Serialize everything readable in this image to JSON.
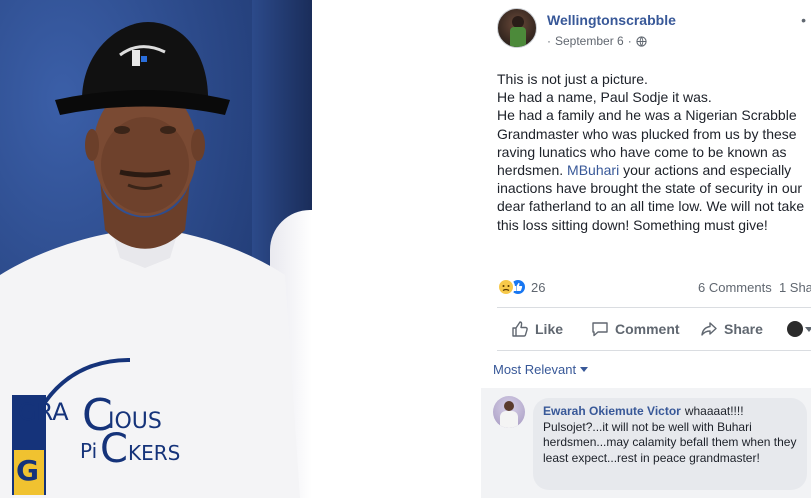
{
  "post": {
    "page_name": "Wellingtonscrabble",
    "date": "September 6",
    "separator": "·",
    "more": "•",
    "text_lines": [
      "This is not just a picture.",
      "He had a name, Paul Sodje it was.",
      "He had a family and he was a Nigerian Scrabble Grandmaster who was plucked from us by these raving lunatics who have come to be known as herdsmen."
    ],
    "mention": "MBuhari",
    "text_after_mention": " your actions and especially inactions have brought the state of security in our dear fatherland to an all time low. We will not take this loss sitting down! Something must give!"
  },
  "photo": {
    "shirt_text_line1": "GRACIOUS",
    "shirt_text_line2": "PICKERS",
    "shirt_text_line1_display": "GRA",
    "shirt_text_line1_c": "C",
    "shirt_text_line1_rest": "IOUS",
    "shirt_text_line2_pi": "Pi",
    "shirt_text_line2_c": "C",
    "shirt_text_line2_rest": "KERS",
    "tile_letter": "G"
  },
  "reactions": {
    "count": "26",
    "comments": "6 Comments",
    "shares": "1 Sha"
  },
  "actions": {
    "like": "Like",
    "comment": "Comment",
    "share": "Share"
  },
  "comments": {
    "sort_label": "Most Relevant",
    "items": [
      {
        "author": "Ewarah Okiemute Victor",
        "text": "whaaaat!!!! Pulsojet?...it will not be well with Buhari herdsmen...may calamity befall them when they least expect...rest in peace grandmaster!"
      }
    ]
  },
  "colors": {
    "link": "#385898",
    "photo_bg": "#2a4d8e",
    "comment_bg": "#e7e9ed",
    "like_blue": "#1877f2"
  }
}
